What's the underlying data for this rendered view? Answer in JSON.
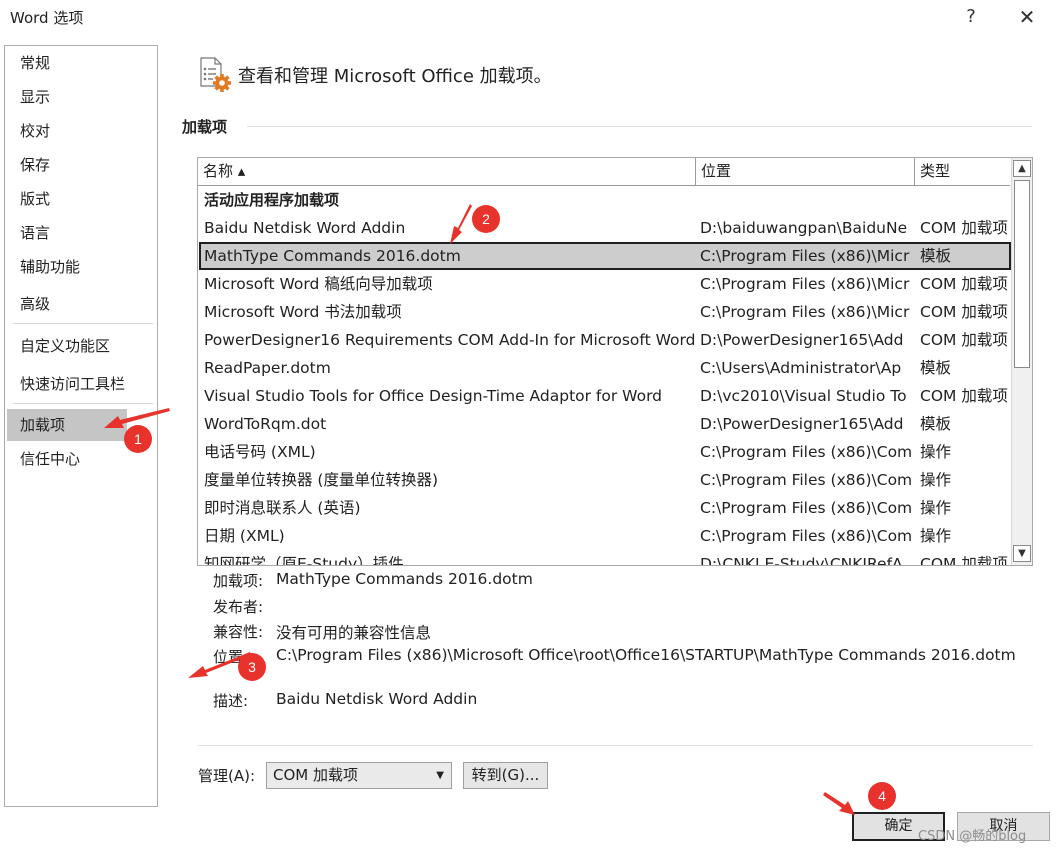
{
  "window": {
    "title": "Word 选项",
    "help_glyph": "?",
    "close_glyph": "✕"
  },
  "sidebar": {
    "items": [
      {
        "label": "常规"
      },
      {
        "label": "显示"
      },
      {
        "label": "校对"
      },
      {
        "label": "保存"
      },
      {
        "label": "版式"
      },
      {
        "label": "语言"
      },
      {
        "label": "辅助功能"
      },
      {
        "label": "高级"
      },
      {
        "label": "自定义功能区"
      },
      {
        "label": "快速访问工具栏"
      },
      {
        "label": "加载项",
        "selected": true
      },
      {
        "label": "信任中心"
      }
    ]
  },
  "header": {
    "title": "查看和管理 Microsoft Office 加载项。",
    "icon": "addins-gear-icon"
  },
  "section": {
    "title": "加载项"
  },
  "table": {
    "columns": [
      "名称 ▴",
      "位置",
      "类型"
    ],
    "group_label": "活动应用程序加载项",
    "rows": [
      {
        "name": "Baidu Netdisk Word Addin",
        "location": "D:\\baiduwangpan\\BaiduNe",
        "type": "COM 加载项"
      },
      {
        "name": "MathType Commands 2016.dotm",
        "location": "C:\\Program Files (x86)\\Micr",
        "type": "模板",
        "selected": true
      },
      {
        "name": "Microsoft Word 稿纸向导加载项",
        "location": "C:\\Program Files (x86)\\Micr",
        "type": "COM 加载项"
      },
      {
        "name": "Microsoft Word 书法加载项",
        "location": "C:\\Program Files (x86)\\Micr",
        "type": "COM 加载项"
      },
      {
        "name": "PowerDesigner16 Requirements COM Add-In for Microsoft Word",
        "location": "D:\\PowerDesigner165\\Add",
        "type": "COM 加载项"
      },
      {
        "name": "ReadPaper.dotm",
        "location": "C:\\Users\\Administrator\\Ap",
        "type": "模板"
      },
      {
        "name": "Visual Studio Tools for Office Design-Time Adaptor for Word",
        "location": "D:\\vc2010\\Visual Studio To",
        "type": "COM 加载项"
      },
      {
        "name": "WordToRqm.dot",
        "location": "D:\\PowerDesigner165\\Add",
        "type": "模板"
      },
      {
        "name": "电话号码 (XML)",
        "location": "C:\\Program Files (x86)\\Com",
        "type": "操作"
      },
      {
        "name": "度量单位转换器 (度量单位转换器)",
        "location": "C:\\Program Files (x86)\\Com",
        "type": "操作"
      },
      {
        "name": "即时消息联系人 (英语)",
        "location": "C:\\Program Files (x86)\\Com",
        "type": "操作"
      },
      {
        "name": "日期 (XML)",
        "location": "C:\\Program Files (x86)\\Com",
        "type": "操作"
      },
      {
        "name": "知网研学（原E-Study）插件",
        "location": "D:\\CNKI E-Study\\CNKIRefA",
        "type": "COM 加载项"
      }
    ]
  },
  "details": {
    "addin_label": "加载项:",
    "addin_value": "MathType Commands 2016.dotm",
    "publisher_label": "发布者:",
    "publisher_value": "",
    "compat_label": "兼容性:",
    "compat_value": "没有可用的兼容性信息",
    "location_label": "位置:",
    "location_value": "C:\\Program Files (x86)\\Microsoft Office\\root\\Office16\\STARTUP\\MathType Commands 2016.dotm",
    "desc_label": "描述:",
    "desc_value": "Baidu Netdisk Word Addin"
  },
  "manage": {
    "label": "管理(A):",
    "selected": "COM 加载项",
    "go_button": "转到(G)..."
  },
  "buttons": {
    "ok": "确定",
    "cancel": "取消"
  },
  "annotations": {
    "badges": [
      "1",
      "2",
      "3",
      "4"
    ],
    "color": "#e8332c"
  },
  "watermark": "CSDN @畅的blog"
}
